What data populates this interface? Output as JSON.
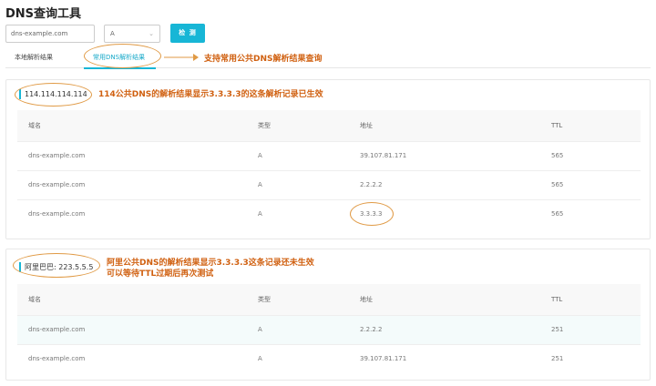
{
  "page_title": "DNS查询工具",
  "search": {
    "domain_value": "dns-example.com",
    "record_type": "A",
    "check_label": "检 测"
  },
  "tabs": [
    {
      "label": "本地解析结果"
    },
    {
      "label": "常用DNS解析结果"
    }
  ],
  "annotations": {
    "tab_note": "支持常用公共DNS解析结果查询",
    "panel1_note_prefix": "114",
    "panel1_note_rest": "公共DNS的解析结果显示3.3.3.3的这条解析记录已生效",
    "panel2_note_line1": "阿里公共DNS的解析结果显示3.3.3.3这条记录还未生效",
    "panel2_note_line2": "可以等待TTL过期后再次测试"
  },
  "table_headers": [
    "域名",
    "类型",
    "地址",
    "TTL"
  ],
  "panels": [
    {
      "title": "114.114.114.114",
      "rows": [
        [
          "dns-example.com",
          "A",
          "39.107.81.171",
          "565"
        ],
        [
          "dns-example.com",
          "A",
          "2.2.2.2",
          "565"
        ],
        [
          "dns-example.com",
          "A",
          "3.3.3.3",
          "565"
        ]
      ]
    },
    {
      "title": "阿里巴巴: 223.5.5.5",
      "rows": [
        [
          "dns-example.com",
          "A",
          "2.2.2.2",
          "251"
        ],
        [
          "dns-example.com",
          "A",
          "39.107.81.171",
          "251"
        ]
      ]
    }
  ],
  "colors": {
    "accent": "#17b6d6",
    "annotation": "#d06010",
    "oval": "#e09a45"
  }
}
